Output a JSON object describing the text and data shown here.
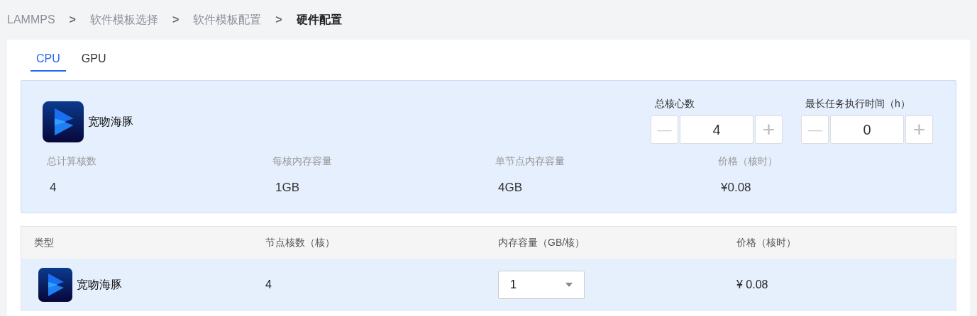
{
  "breadcrumb": [
    {
      "label": "LAMMPS",
      "current": false
    },
    {
      "label": "软件模板选择",
      "current": false
    },
    {
      "label": "软件模板配置",
      "current": false
    },
    {
      "label": "硬件配置",
      "current": true
    }
  ],
  "breadcrumb_separator": ">",
  "tabs": [
    {
      "label": "CPU",
      "selected": true
    },
    {
      "label": "GPU",
      "selected": false
    }
  ],
  "summary": {
    "name": "宽吻海豚",
    "steppers": [
      {
        "label": "总核心数",
        "value": "4",
        "minus": "—",
        "plus": "+"
      },
      {
        "label": "最长任务执行时间（h）",
        "value": "0",
        "minus": "—",
        "plus": "+"
      }
    ],
    "stats": [
      {
        "label": "总计算核数",
        "value": "4"
      },
      {
        "label": "每核内存容量",
        "value": "1GB"
      },
      {
        "label": "单节点内存容量",
        "value": "4GB"
      },
      {
        "label": "价格（核时）",
        "value": "¥0.08"
      }
    ]
  },
  "table": {
    "columns": [
      "类型",
      "节点核数（核）",
      "内存容量（GB/核）",
      "价格（核时）"
    ],
    "rows": [
      {
        "type": "宽吻海豚",
        "cores": "4",
        "memory": "1",
        "price": "¥ 0.08",
        "selected": true
      }
    ]
  }
}
